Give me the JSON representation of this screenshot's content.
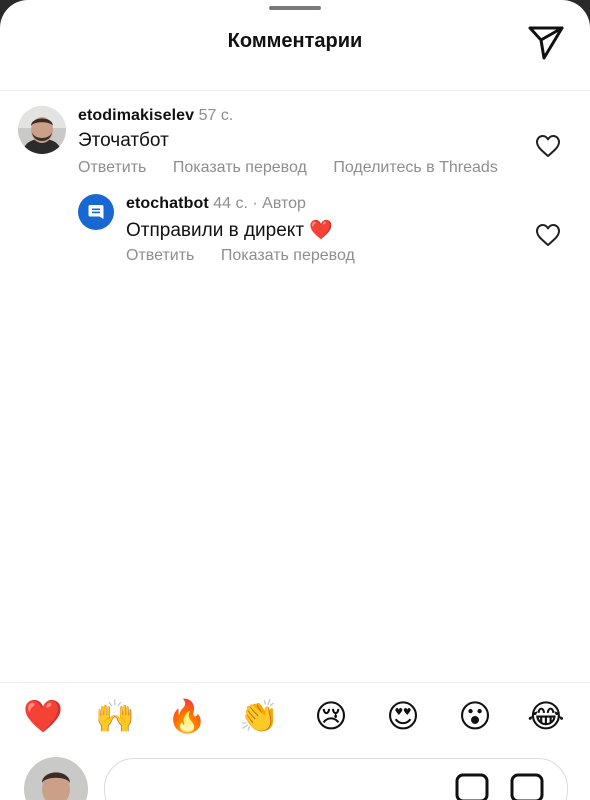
{
  "header": {
    "title": "Комментарии",
    "share_icon": "send-icon"
  },
  "comments": [
    {
      "username": "etodimakiselev",
      "time": "57 с.",
      "text": "Эточатбот",
      "actions": [
        "Ответить",
        "Показать перевод",
        "Поделитесь в Threads"
      ],
      "liked": false
    },
    {
      "username": "etochatbot",
      "time": "44 с.",
      "badge": "· Автор",
      "text": "Отправили в директ",
      "text_emoji": "❤️",
      "actions": [
        "Ответить",
        "Показать перевод"
      ],
      "liked": false,
      "avatar_color": "#1967d2"
    }
  ],
  "reactions": [
    "❤️",
    "🙌",
    "🔥",
    "👏",
    "😢",
    "😍",
    "😮",
    "😂"
  ],
  "composer": {
    "placeholder": ""
  }
}
